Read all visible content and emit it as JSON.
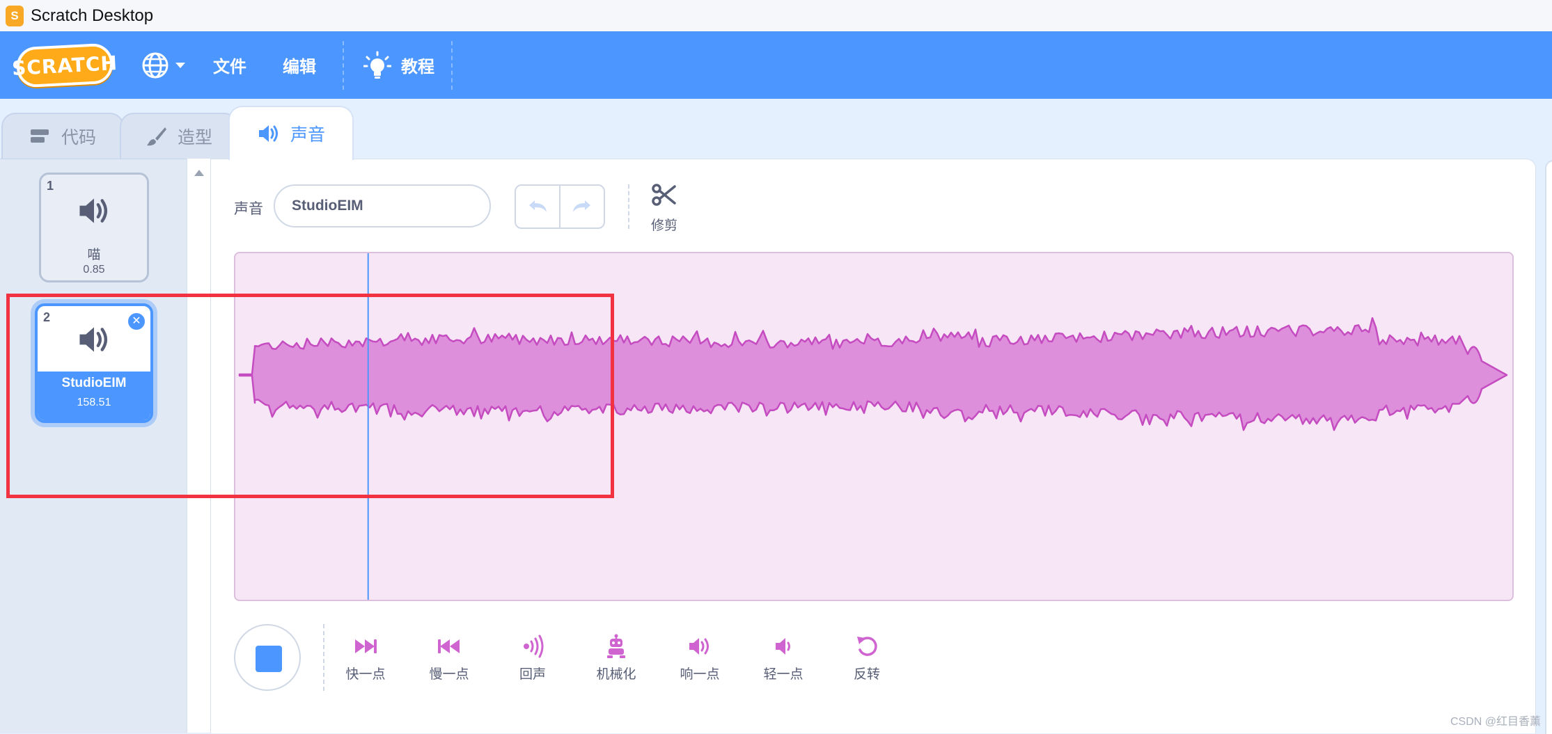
{
  "window": {
    "title": "Scratch Desktop"
  },
  "menubar": {
    "logo_text": "SCRATCH",
    "language_icon": "globe-icon",
    "file_label": "文件",
    "edit_label": "编辑",
    "tutorials_label": "教程",
    "tutorials_icon": "lightbulb-icon"
  },
  "tabs": [
    {
      "label": "代码",
      "icon": "code-blocks-icon",
      "selected": false
    },
    {
      "label": "造型",
      "icon": "paintbrush-icon",
      "selected": false
    },
    {
      "label": "声音",
      "icon": "speaker-icon",
      "selected": true
    }
  ],
  "sounds": [
    {
      "number": "1",
      "name": "喵",
      "duration": "0.85",
      "selected": false
    },
    {
      "number": "2",
      "name": "StudioEIM",
      "duration": "158.51",
      "selected": true
    }
  ],
  "editor": {
    "name_label": "声音",
    "sound_name_value": "StudioEIM",
    "trim_label": "修剪",
    "playhead_fraction": 0.104
  },
  "effects": [
    {
      "label": "快一点",
      "icon": "faster-icon"
    },
    {
      "label": "慢一点",
      "icon": "slower-icon"
    },
    {
      "label": "回声",
      "icon": "echo-icon"
    },
    {
      "label": "机械化",
      "icon": "robot-icon"
    },
    {
      "label": "响一点",
      "icon": "louder-icon"
    },
    {
      "label": "轻一点",
      "icon": "softer-icon"
    },
    {
      "label": "反转",
      "icon": "reverse-icon"
    }
  ],
  "colors": {
    "accent": "#4c97ff",
    "waveform_fill": "#de8fdc",
    "waveform_stroke": "#c54cc0",
    "highlight": "#f23240"
  },
  "watermark": "CSDN @红目香薰"
}
